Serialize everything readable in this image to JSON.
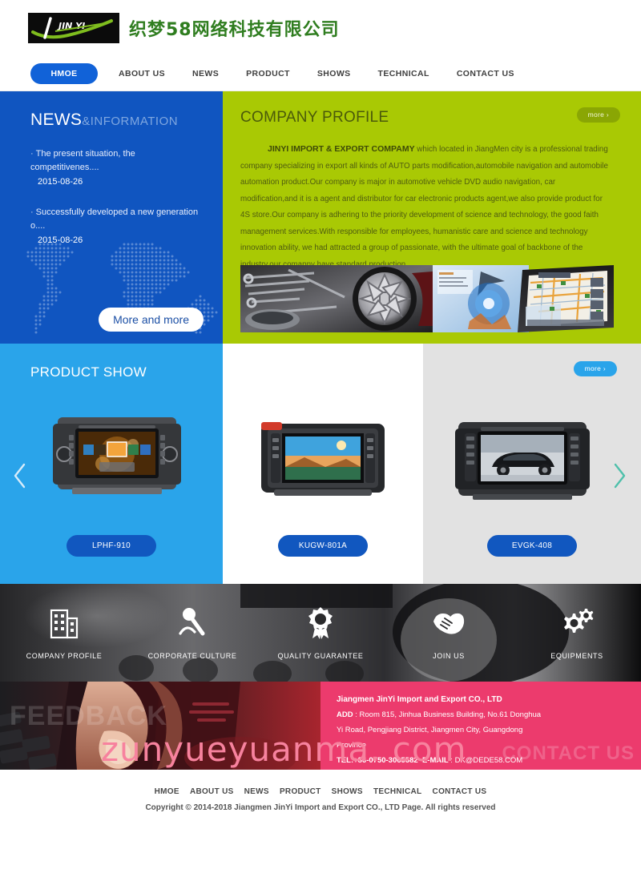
{
  "header": {
    "logo_alt": "JIN YI",
    "logo_text": "JIN YI",
    "company_name_cn": "织梦58网络科技有限公司"
  },
  "nav": {
    "items": [
      {
        "label": "HMOE",
        "active": true
      },
      {
        "label": "ABOUT US",
        "active": false
      },
      {
        "label": "NEWS",
        "active": false
      },
      {
        "label": "PRODUCT",
        "active": false
      },
      {
        "label": "SHOWS",
        "active": false
      },
      {
        "label": "TECHNICAL",
        "active": false
      },
      {
        "label": "CONTACT US",
        "active": false
      }
    ]
  },
  "news": {
    "title_main": "NEWS",
    "title_sub": "&INFORMATION",
    "items": [
      {
        "title": "The present situation, the competitivenes....",
        "date": "2015-08-26"
      },
      {
        "title": "Successfully developed a new generation o....",
        "date": "2015-08-26"
      }
    ],
    "more_label": "More and more"
  },
  "profile": {
    "title": "COMPANY PROFILE",
    "more_label": "more ›",
    "lead": "JINYI IMPORT & EXPORT COMPAMY",
    "body": " which located in JiangMen city is a professional trading company specializing in export all kinds of AUTO parts modification,automobile navigation and automobile automation product.Our company is major in automotive vehicle DVD audio navigation, car modification,and it is a agent and distributor for car electronic products agent,we also provide product for 4S store.Our company is adhering to the priority development of science and technology, the good faith management services.With responsible for employees, humanistic care and science and technology innovation ability, we had attracted a group of passionate, with the ultimate goal of backbone of the industry,our comapny have standard production ..."
  },
  "product_show": {
    "title": "PRODUCT SHOW",
    "more_label": "more ›",
    "watermark": "zunyueyuanma. com",
    "items": [
      {
        "label": "LPHF-910"
      },
      {
        "label": "KUGW-801A"
      },
      {
        "label": "EVGK-408"
      }
    ],
    "prev_label": "‹",
    "next_label": "›"
  },
  "features": [
    {
      "label": "COMPANY PROFILE",
      "icon": "building-icon"
    },
    {
      "label": "CORPORATE CULTURE",
      "icon": "microphone-icon"
    },
    {
      "label": "QUALITY GUARANTEE",
      "icon": "award-ribbon-icon"
    },
    {
      "label": "JOIN US",
      "icon": "handshake-icon"
    },
    {
      "label": "EQUIPMENTS",
      "icon": "gears-icon"
    }
  ],
  "feedback": {
    "word": "FEEDBACK",
    "ghost": "CONTACT US",
    "company": "Jiangmen JinYi Import and Export CO., LTD",
    "add_label": "ADD",
    "add_value": " : Room 815, Jinhua Business Building, No.61 Donghua",
    "add_line2": "Yi Road, Pengjiang District, Jiangmen City, Guangdong",
    "add_line3": "Province",
    "tel_label": "TEL:+86-0750-3065582",
    "email_label": "E-MAIL",
    "email_value": " : DK@DEDE58.COM"
  },
  "footer": {
    "nav": [
      "HMOE",
      "ABOUT US",
      "NEWS",
      "PRODUCT",
      "SHOWS",
      "TECHNICAL",
      "CONTACT US"
    ],
    "copyright": "Copyright © 2014-2018 Jiangmen JinYi Import and Export CO., LTD   Page. All rights reserved"
  },
  "colors": {
    "brand_blue": "#1055c0",
    "brand_green": "#a9c904",
    "brand_cyan": "#2aa4ea",
    "brand_pink": "#ec3b6d",
    "nav_active": "#1162d8",
    "watermark_pink": "#f7829e"
  }
}
